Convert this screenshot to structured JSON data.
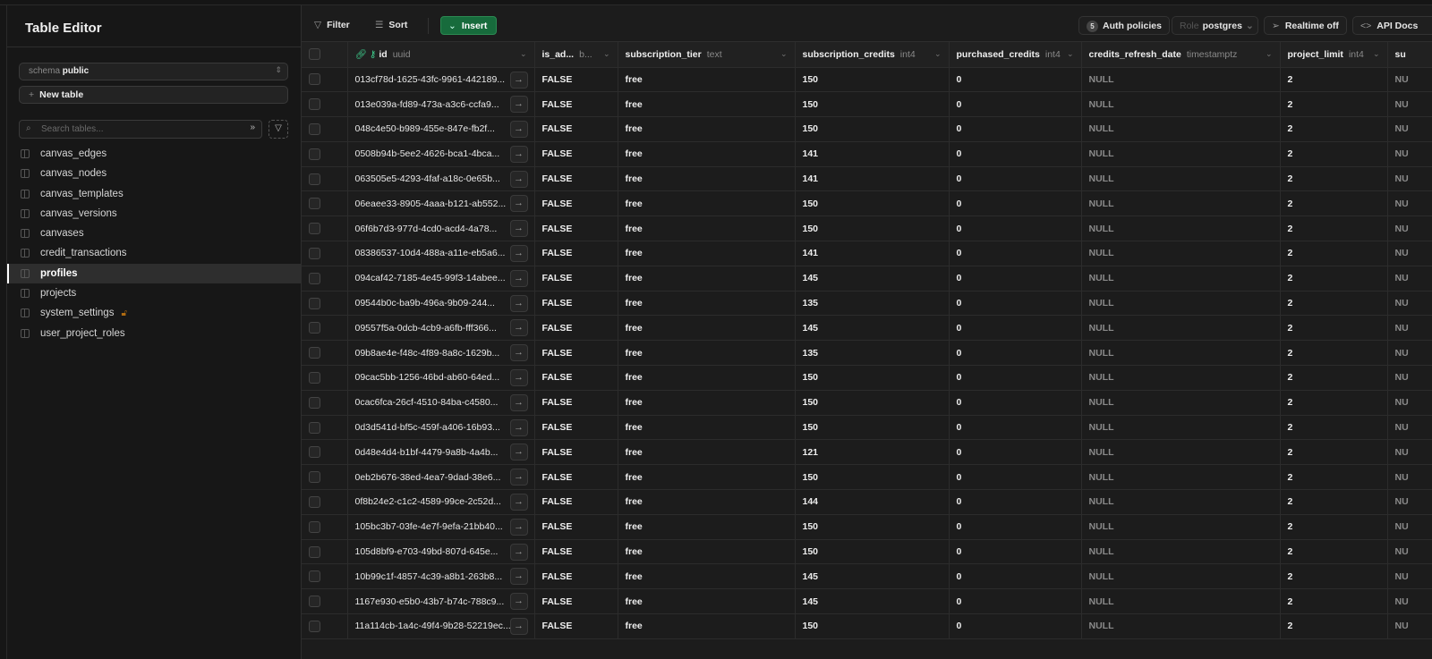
{
  "sidebar": {
    "title": "Table Editor",
    "schema_label": "schema",
    "schema_value": "public",
    "new_table": "New table",
    "search_placeholder": "Search tables...",
    "tables": [
      {
        "name": "canvas_edges"
      },
      {
        "name": "canvas_nodes"
      },
      {
        "name": "canvas_templates"
      },
      {
        "name": "canvas_versions"
      },
      {
        "name": "canvases"
      },
      {
        "name": "credit_transactions"
      },
      {
        "name": "profiles",
        "active": true
      },
      {
        "name": "projects"
      },
      {
        "name": "system_settings",
        "locked": true
      },
      {
        "name": "user_project_roles"
      }
    ]
  },
  "toolbar": {
    "filter": "Filter",
    "sort": "Sort",
    "insert": "Insert",
    "auth_count": "5",
    "auth_policies": "Auth policies",
    "role_label": "Role",
    "role_value": "postgres",
    "realtime": "Realtime off",
    "api_docs": "API Docs"
  },
  "columns": [
    {
      "name": "id",
      "type": "uuid"
    },
    {
      "name": "is_ad...",
      "type": "b..."
    },
    {
      "name": "subscription_tier",
      "type": "text"
    },
    {
      "name": "subscription_credits",
      "type": "int4"
    },
    {
      "name": "purchased_credits",
      "type": "int4"
    },
    {
      "name": "credits_refresh_date",
      "type": "timestamptz"
    },
    {
      "name": "project_limit",
      "type": "int4"
    },
    {
      "name": "su",
      "type": ""
    }
  ],
  "rows": [
    [
      "013cf78d-1625-43fc-9961-442189...",
      "FALSE",
      "free",
      "150",
      "0",
      "NULL",
      "2",
      "NU"
    ],
    [
      "013e039a-fd89-473a-a3c6-ccfa9...",
      "FALSE",
      "free",
      "150",
      "0",
      "NULL",
      "2",
      "NU"
    ],
    [
      "048c4e50-b989-455e-847e-fb2f...",
      "FALSE",
      "free",
      "150",
      "0",
      "NULL",
      "2",
      "NU"
    ],
    [
      "0508b94b-5ee2-4626-bca1-4bca...",
      "FALSE",
      "free",
      "141",
      "0",
      "NULL",
      "2",
      "NU"
    ],
    [
      "063505e5-4293-4faf-a18c-0e65b...",
      "FALSE",
      "free",
      "141",
      "0",
      "NULL",
      "2",
      "NU"
    ],
    [
      "06eaee33-8905-4aaa-b121-ab552...",
      "FALSE",
      "free",
      "150",
      "0",
      "NULL",
      "2",
      "NU"
    ],
    [
      "06f6b7d3-977d-4cd0-acd4-4a78...",
      "FALSE",
      "free",
      "150",
      "0",
      "NULL",
      "2",
      "NU"
    ],
    [
      "08386537-10d4-488a-a11e-eb5a6...",
      "FALSE",
      "free",
      "141",
      "0",
      "NULL",
      "2",
      "NU"
    ],
    [
      "094caf42-7185-4e45-99f3-14abee...",
      "FALSE",
      "free",
      "145",
      "0",
      "NULL",
      "2",
      "NU"
    ],
    [
      "09544b0c-ba9b-496a-9b09-244...",
      "FALSE",
      "free",
      "135",
      "0",
      "NULL",
      "2",
      "NU"
    ],
    [
      "09557f5a-0dcb-4cb9-a6fb-fff366...",
      "FALSE",
      "free",
      "145",
      "0",
      "NULL",
      "2",
      "NU"
    ],
    [
      "09b8ae4e-f48c-4f89-8a8c-1629b...",
      "FALSE",
      "free",
      "135",
      "0",
      "NULL",
      "2",
      "NU"
    ],
    [
      "09cac5bb-1256-46bd-ab60-64ed...",
      "FALSE",
      "free",
      "150",
      "0",
      "NULL",
      "2",
      "NU"
    ],
    [
      "0cac6fca-26cf-4510-84ba-c4580...",
      "FALSE",
      "free",
      "150",
      "0",
      "NULL",
      "2",
      "NU"
    ],
    [
      "0d3d541d-bf5c-459f-a406-16b93...",
      "FALSE",
      "free",
      "150",
      "0",
      "NULL",
      "2",
      "NU"
    ],
    [
      "0d48e4d4-b1bf-4479-9a8b-4a4b...",
      "FALSE",
      "free",
      "121",
      "0",
      "NULL",
      "2",
      "NU"
    ],
    [
      "0eb2b676-38ed-4ea7-9dad-38e6...",
      "FALSE",
      "free",
      "150",
      "0",
      "NULL",
      "2",
      "NU"
    ],
    [
      "0f8b24e2-c1c2-4589-99ce-2c52d...",
      "FALSE",
      "free",
      "144",
      "0",
      "NULL",
      "2",
      "NU"
    ],
    [
      "105bc3b7-03fe-4e7f-9efa-21bb40...",
      "FALSE",
      "free",
      "150",
      "0",
      "NULL",
      "2",
      "NU"
    ],
    [
      "105d8bf9-e703-49bd-807d-645e...",
      "FALSE",
      "free",
      "150",
      "0",
      "NULL",
      "2",
      "NU"
    ],
    [
      "10b99c1f-4857-4c39-a8b1-263b8...",
      "FALSE",
      "free",
      "145",
      "0",
      "NULL",
      "2",
      "NU"
    ],
    [
      "1167e930-e5b0-43b7-b74c-788c9...",
      "FALSE",
      "free",
      "145",
      "0",
      "NULL",
      "2",
      "NU"
    ],
    [
      "11a114cb-1a4c-49f4-9b28-52219ec...",
      "FALSE",
      "free",
      "150",
      "0",
      "NULL",
      "2",
      "NU"
    ]
  ]
}
